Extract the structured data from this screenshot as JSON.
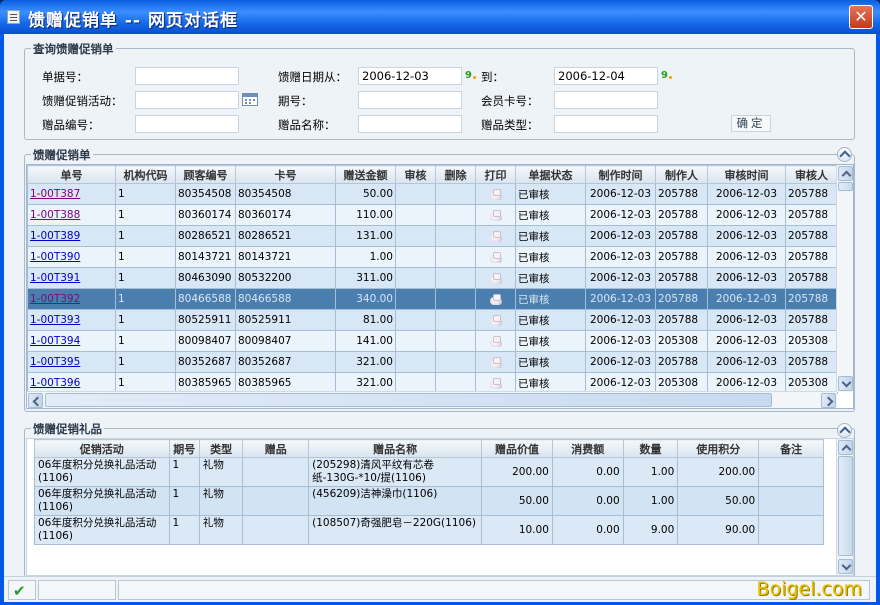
{
  "window": {
    "title": "馈赠促销单 -- 网页对话框",
    "close_glyph": "✕",
    "icon": "document-icon"
  },
  "query": {
    "legend": "查询馈赠促销单",
    "doc_no_label": "单据号：",
    "doc_no_value": "",
    "date_from_label": "馈赠日期从：",
    "date_from_value": "2006-12-03",
    "date_to_label": "到：",
    "date_to_value": "2006-12-04",
    "activity_label": "馈赠促销活动：",
    "activity_value": "",
    "period_label": "期号：",
    "period_value": "",
    "member_label": "会员卡号：",
    "member_value": "",
    "gift_no_label": "赠品编号：",
    "gift_no_value": "",
    "gift_name_label": "赠品名称：",
    "gift_name_value": "",
    "gift_type_label": "赠品类型：",
    "gift_type_value": "",
    "ok_label": "确定"
  },
  "orders": {
    "legend": "馈赠促销单",
    "columns": [
      "单号",
      "机构代码",
      "顾客编号",
      "卡号",
      "赠送金额",
      "审核",
      "删除",
      "打印",
      "单据状态",
      "制作时间",
      "制作人",
      "审核时间",
      "审核人"
    ],
    "selected_index": 5,
    "rows": [
      {
        "no": "1-00T387",
        "org": "1",
        "cust": "80354508",
        "card": "80354508",
        "amount": "50.00",
        "status": "已审核",
        "made": "2006-12-03",
        "maker": "205788",
        "audit_time": "2006-12-03",
        "auditor": "205788"
      },
      {
        "no": "1-00T388",
        "org": "1",
        "cust": "80360174",
        "card": "80360174",
        "amount": "110.00",
        "status": "已审核",
        "made": "2006-12-03",
        "maker": "205788",
        "audit_time": "2006-12-03",
        "auditor": "205788"
      },
      {
        "no": "1-00T389",
        "org": "1",
        "cust": "80286521",
        "card": "80286521",
        "amount": "131.00",
        "status": "已审核",
        "made": "2006-12-03",
        "maker": "205788",
        "audit_time": "2006-12-03",
        "auditor": "205788"
      },
      {
        "no": "1-00T390",
        "org": "1",
        "cust": "80143721",
        "card": "80143721",
        "amount": "1.00",
        "status": "已审核",
        "made": "2006-12-03",
        "maker": "205788",
        "audit_time": "2006-12-03",
        "auditor": "205788"
      },
      {
        "no": "1-00T391",
        "org": "1",
        "cust": "80463090",
        "card": "80532200",
        "amount": "311.00",
        "status": "已审核",
        "made": "2006-12-03",
        "maker": "205788",
        "audit_time": "2006-12-03",
        "auditor": "205788"
      },
      {
        "no": "1-00T392",
        "org": "1",
        "cust": "80466588",
        "card": "80466588",
        "amount": "340.00",
        "status": "已审核",
        "made": "2006-12-03",
        "maker": "205788",
        "audit_time": "2006-12-03",
        "auditor": "205788"
      },
      {
        "no": "1-00T393",
        "org": "1",
        "cust": "80525911",
        "card": "80525911",
        "amount": "81.00",
        "status": "已审核",
        "made": "2006-12-03",
        "maker": "205788",
        "audit_time": "2006-12-03",
        "auditor": "205788"
      },
      {
        "no": "1-00T394",
        "org": "1",
        "cust": "80098407",
        "card": "80098407",
        "amount": "141.00",
        "status": "已审核",
        "made": "2006-12-03",
        "maker": "205308",
        "audit_time": "2006-12-03",
        "auditor": "205308"
      },
      {
        "no": "1-00T395",
        "org": "1",
        "cust": "80352687",
        "card": "80352687",
        "amount": "321.00",
        "status": "已审核",
        "made": "2006-12-03",
        "maker": "205788",
        "audit_time": "2006-12-03",
        "auditor": "205788"
      },
      {
        "no": "1-00T396",
        "org": "1",
        "cust": "80385965",
        "card": "80385965",
        "amount": "321.00",
        "status": "已审核",
        "made": "2006-12-03",
        "maker": "205308",
        "audit_time": "2006-12-03",
        "auditor": "205308"
      }
    ]
  },
  "gifts": {
    "legend": "馈赠促销礼品",
    "columns": [
      "促销活动",
      "期号",
      "类型",
      "赠品",
      "赠品名称",
      "赠品价值",
      "消费额",
      "数量",
      "使用积分",
      "备注"
    ],
    "rows": [
      {
        "activity": "06年度积分兑换礼品活动(1106)",
        "period": "1",
        "type": "礼物",
        "gift": "",
        "name": "(205298)清风平纹有芯卷纸-130G-*10/提(1106)",
        "value": "200.00",
        "spend": "0.00",
        "qty": "1.00",
        "points": "200.00",
        "remark": ""
      },
      {
        "activity": "06年度积分兑换礼品活动(1106)",
        "period": "1",
        "type": "礼物",
        "gift": "",
        "name": "(456209)洁神澡巾(1106)",
        "value": "50.00",
        "spend": "0.00",
        "qty": "1.00",
        "points": "50.00",
        "remark": ""
      },
      {
        "activity": "06年度积分兑换礼品活动(1106)",
        "period": "1",
        "type": "礼物",
        "gift": "",
        "name": "(108507)奇强肥皂－220G(1106)",
        "value": "10.00",
        "spend": "0.00",
        "qty": "9.00",
        "points": "90.00",
        "remark": ""
      }
    ]
  },
  "status": {
    "ok_icon": "check-icon"
  },
  "watermark": "Boigel.com",
  "colors": {
    "titlebar": "#0a5fe0",
    "selected_row": "#4a7eaf",
    "row_bg": "#d8e7f5",
    "link": "#0000cc",
    "watermark": "#e8c200"
  }
}
